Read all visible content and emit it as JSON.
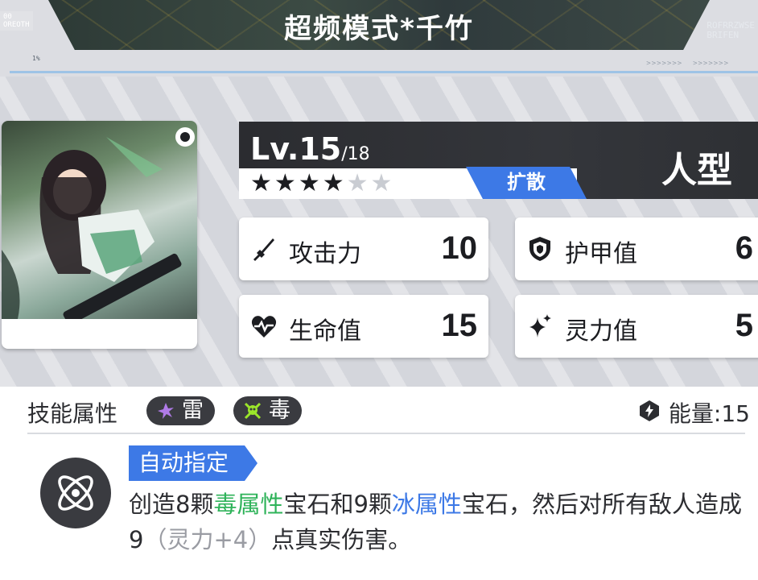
{
  "banner": {
    "title": "超频模式*千竹",
    "code_left": "00\nOREOTH",
    "code_right": "ROFRRZWSE\nBRIFEN",
    "tag": "1%",
    "arrows": ">>>>>>>  >>>>>>>"
  },
  "character": {
    "level": "Lv.15",
    "level_max": "/18",
    "stars_total": 6,
    "stars_filled": 4,
    "element": "扩散",
    "type": "人型"
  },
  "stats": {
    "attack": {
      "label": "攻击力",
      "value": "10"
    },
    "armor": {
      "label": "护甲值",
      "value": "6"
    },
    "hp": {
      "label": "生命值",
      "value": "15"
    },
    "spirit": {
      "label": "灵力值",
      "value": "5"
    }
  },
  "skill": {
    "section_title": "技能属性",
    "attributes": [
      {
        "label": "雷",
        "icon": "thunder-icon",
        "color": "#b07be8"
      },
      {
        "label": "毒",
        "icon": "poison-icon",
        "color": "#9be52a"
      }
    ],
    "energy": "能量:15",
    "target": "自动指定",
    "desc": {
      "p1": "创造8颗",
      "p2": "毒属性",
      "p3": "宝石和9颗",
      "p4": "冰属性",
      "p5": "宝石，然后对所有敌人造成9",
      "p6": "（灵力+4）",
      "p7": "点真实伤害。"
    }
  },
  "colors": {
    "accent_blue": "#3d79e6",
    "poison_green": "#2fb35a",
    "dark": "#2b2c30"
  }
}
